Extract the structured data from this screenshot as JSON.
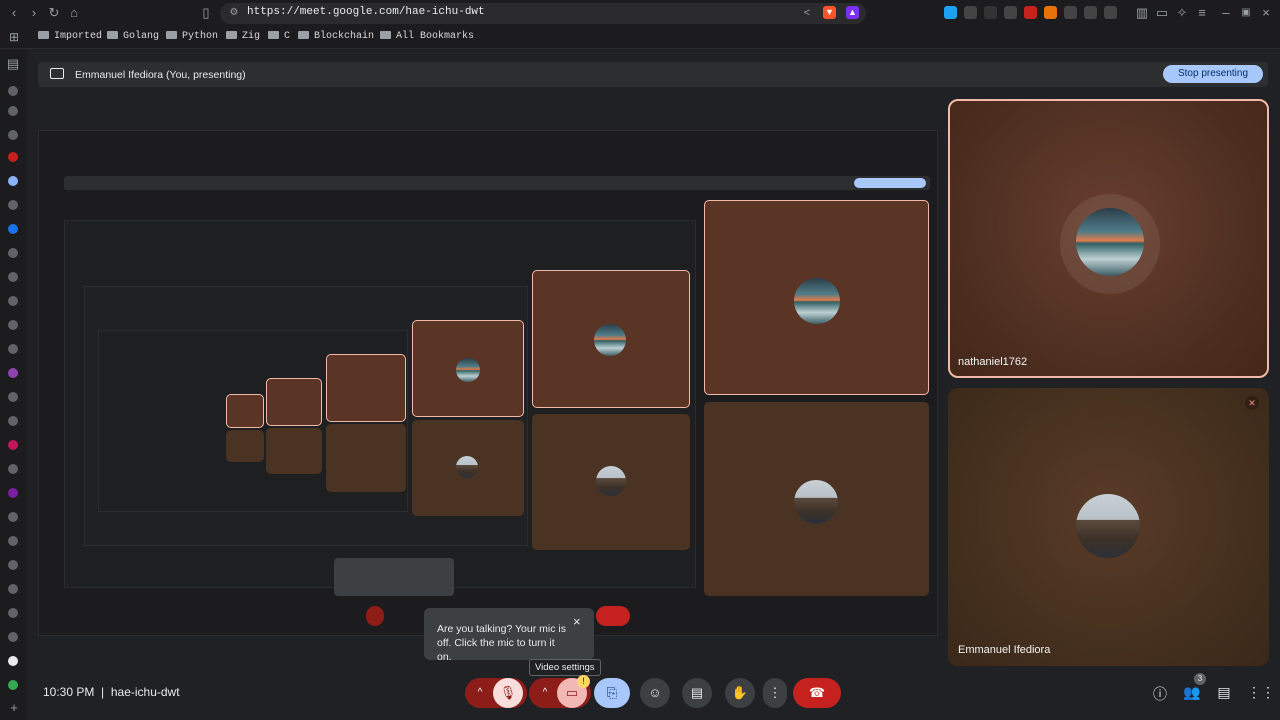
{
  "browser": {
    "url": "https://meet.google.com/hae-ichu-dwt",
    "bookmarks": [
      "Imported",
      "Golang",
      "Python",
      "Zig",
      "C",
      "Blockchain",
      "All Bookmarks"
    ],
    "icons": {
      "back": "arrow-left-icon",
      "forward": "arrow-right-icon",
      "reload": "reload-icon",
      "home": "home-icon",
      "bookmark": "bookmark-icon",
      "share": "share-icon",
      "brave": "brave-shield-icon",
      "rewards": "brave-rewards-icon"
    }
  },
  "meet": {
    "presenting_banner": "Emmanuel Ifediora (You, presenting)",
    "stop_presenting_label": "Stop presenting",
    "participants": [
      {
        "name": "nathaniel1762",
        "active_speaker": true,
        "muted": false
      },
      {
        "name": "Emmanuel Ifediora",
        "active_speaker": false,
        "muted": true
      }
    ],
    "mic_tooltip": "Are you talking? Your mic is off. Click the mic to turn it on.",
    "video_settings_label": "Video settings",
    "time": "10:30 PM",
    "separator": "|",
    "meeting_code": "hae-ichu-dwt",
    "participant_count": "3",
    "alert_badge": "!",
    "colors": {
      "accent_blue": "#a8c7fa",
      "end_call_red": "#c5221f",
      "muted_red": "#8c1d18",
      "tile_highlight": "#f3b9a8"
    }
  }
}
